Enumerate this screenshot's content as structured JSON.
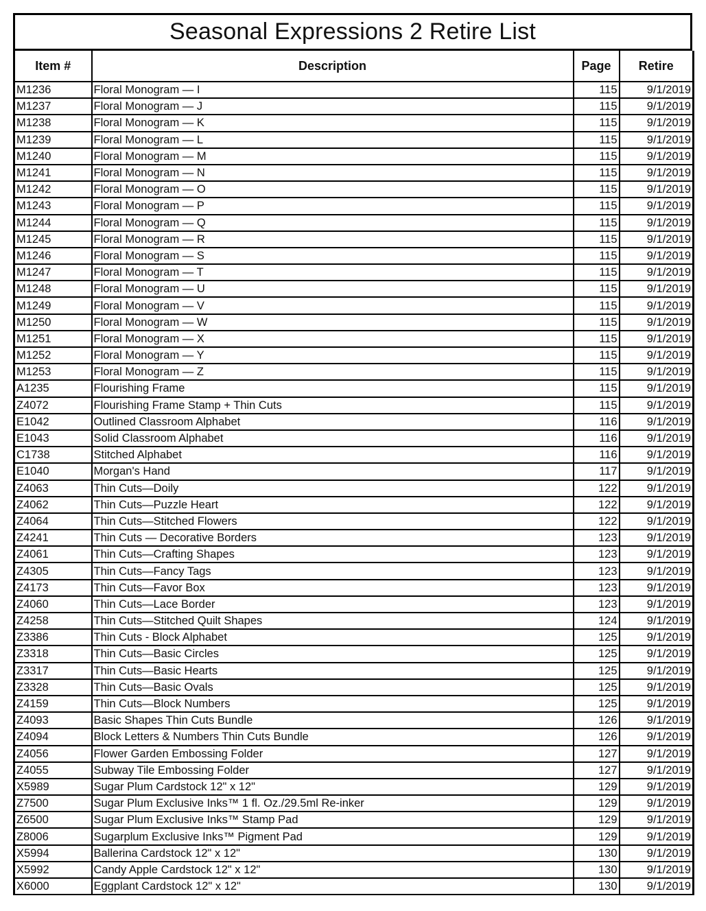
{
  "title": "Seasonal Expressions 2 Retire List",
  "columns": {
    "item": "Item #",
    "description": "Description",
    "page": "Page",
    "retire": "Retire"
  },
  "rows": [
    {
      "item": "M1236",
      "description": "Floral Monogram — I",
      "page": "115",
      "retire": "9/1/2019"
    },
    {
      "item": "M1237",
      "description": "Floral Monogram — J",
      "page": "115",
      "retire": "9/1/2019"
    },
    {
      "item": "M1238",
      "description": "Floral Monogram — K",
      "page": "115",
      "retire": "9/1/2019"
    },
    {
      "item": "M1239",
      "description": "Floral Monogram — L",
      "page": "115",
      "retire": "9/1/2019"
    },
    {
      "item": "M1240",
      "description": "Floral Monogram — M",
      "page": "115",
      "retire": "9/1/2019"
    },
    {
      "item": "M1241",
      "description": "Floral Monogram — N",
      "page": "115",
      "retire": "9/1/2019"
    },
    {
      "item": "M1242",
      "description": "Floral Monogram — O",
      "page": "115",
      "retire": "9/1/2019"
    },
    {
      "item": "M1243",
      "description": "Floral Monogram — P",
      "page": "115",
      "retire": "9/1/2019"
    },
    {
      "item": "M1244",
      "description": "Floral Monogram — Q",
      "page": "115",
      "retire": "9/1/2019"
    },
    {
      "item": "M1245",
      "description": "Floral Monogram — R",
      "page": "115",
      "retire": "9/1/2019"
    },
    {
      "item": "M1246",
      "description": "Floral Monogram — S",
      "page": "115",
      "retire": "9/1/2019"
    },
    {
      "item": "M1247",
      "description": "Floral Monogram — T",
      "page": "115",
      "retire": "9/1/2019"
    },
    {
      "item": "M1248",
      "description": "Floral Monogram — U",
      "page": "115",
      "retire": "9/1/2019"
    },
    {
      "item": "M1249",
      "description": "Floral Monogram — V",
      "page": "115",
      "retire": "9/1/2019"
    },
    {
      "item": "M1250",
      "description": "Floral Monogram — W",
      "page": "115",
      "retire": "9/1/2019"
    },
    {
      "item": "M1251",
      "description": "Floral Monogram — X",
      "page": "115",
      "retire": "9/1/2019"
    },
    {
      "item": "M1252",
      "description": "Floral Monogram — Y",
      "page": "115",
      "retire": "9/1/2019"
    },
    {
      "item": "M1253",
      "description": "Floral Monogram — Z",
      "page": "115",
      "retire": "9/1/2019"
    },
    {
      "item": "A1235",
      "description": "Flourishing Frame",
      "page": "115",
      "retire": "9/1/2019"
    },
    {
      "item": "Z4072",
      "description": "Flourishing Frame Stamp + Thin Cuts",
      "page": "115",
      "retire": "9/1/2019"
    },
    {
      "item": "E1042",
      "description": "Outlined Classroom Alphabet",
      "page": "116",
      "retire": "9/1/2019"
    },
    {
      "item": "E1043",
      "description": "Solid Classroom Alphabet",
      "page": "116",
      "retire": "9/1/2019"
    },
    {
      "item": "C1738",
      "description": "Stitched Alphabet",
      "page": "116",
      "retire": "9/1/2019"
    },
    {
      "item": "E1040",
      "description": "Morgan's Hand",
      "page": "117",
      "retire": "9/1/2019"
    },
    {
      "item": "Z4063",
      "description": "Thin Cuts—Doily",
      "page": "122",
      "retire": "9/1/2019"
    },
    {
      "item": "Z4062",
      "description": "Thin Cuts—Puzzle Heart",
      "page": "122",
      "retire": "9/1/2019"
    },
    {
      "item": "Z4064",
      "description": "Thin Cuts—Stitched Flowers",
      "page": "122",
      "retire": "9/1/2019"
    },
    {
      "item": "Z4241",
      "description": "Thin Cuts — Decorative Borders",
      "page": "123",
      "retire": "9/1/2019"
    },
    {
      "item": "Z4061",
      "description": "Thin Cuts—Crafting Shapes",
      "page": "123",
      "retire": "9/1/2019"
    },
    {
      "item": "Z4305",
      "description": "Thin Cuts—Fancy Tags",
      "page": "123",
      "retire": "9/1/2019"
    },
    {
      "item": "Z4173",
      "description": "Thin Cuts—Favor Box",
      "page": "123",
      "retire": "9/1/2019"
    },
    {
      "item": "Z4060",
      "description": "Thin Cuts—Lace Border",
      "page": "123",
      "retire": "9/1/2019"
    },
    {
      "item": "Z4258",
      "description": "Thin Cuts—Stitched Quilt Shapes",
      "page": "124",
      "retire": "9/1/2019"
    },
    {
      "item": "Z3386",
      "description": "Thin Cuts - Block Alphabet",
      "page": "125",
      "retire": "9/1/2019"
    },
    {
      "item": "Z3318",
      "description": "Thin Cuts—Basic Circles",
      "page": "125",
      "retire": "9/1/2019"
    },
    {
      "item": "Z3317",
      "description": "Thin Cuts—Basic Hearts",
      "page": "125",
      "retire": "9/1/2019"
    },
    {
      "item": "Z3328",
      "description": "Thin Cuts—Basic Ovals",
      "page": "125",
      "retire": "9/1/2019"
    },
    {
      "item": "Z4159",
      "description": "Thin Cuts—Block Numbers",
      "page": "125",
      "retire": "9/1/2019"
    },
    {
      "item": "Z4093",
      "description": "Basic Shapes Thin Cuts Bundle",
      "page": "126",
      "retire": "9/1/2019"
    },
    {
      "item": "Z4094",
      "description": "Block Letters & Numbers Thin Cuts Bundle",
      "page": "126",
      "retire": "9/1/2019"
    },
    {
      "item": "Z4056",
      "description": "Flower Garden Embossing Folder",
      "page": "127",
      "retire": "9/1/2019"
    },
    {
      "item": "Z4055",
      "description": "Subway Tile Embossing Folder",
      "page": "127",
      "retire": "9/1/2019"
    },
    {
      "item": "X5989",
      "description": "Sugar Plum Cardstock 12\" x 12\"",
      "page": "129",
      "retire": "9/1/2019"
    },
    {
      "item": "Z7500",
      "description": "Sugar Plum Exclusive Inks™ 1 fl. Oz./29.5ml Re-inker",
      "page": "129",
      "retire": "9/1/2019"
    },
    {
      "item": "Z6500",
      "description": "Sugar Plum Exclusive Inks™ Stamp Pad",
      "page": "129",
      "retire": "9/1/2019"
    },
    {
      "item": "Z8006",
      "description": "Sugarplum Exclusive Inks™ Pigment Pad",
      "page": "129",
      "retire": "9/1/2019"
    },
    {
      "item": "X5994",
      "description": "Ballerina Cardstock 12\" x 12\"",
      "page": "130",
      "retire": "9/1/2019"
    },
    {
      "item": "X5992",
      "description": "Candy Apple Cardstock 12\" x 12\"",
      "page": "130",
      "retire": "9/1/2019"
    },
    {
      "item": "X6000",
      "description": "Eggplant Cardstock 12\" x 12\"",
      "page": "130",
      "retire": "9/1/2019"
    }
  ]
}
